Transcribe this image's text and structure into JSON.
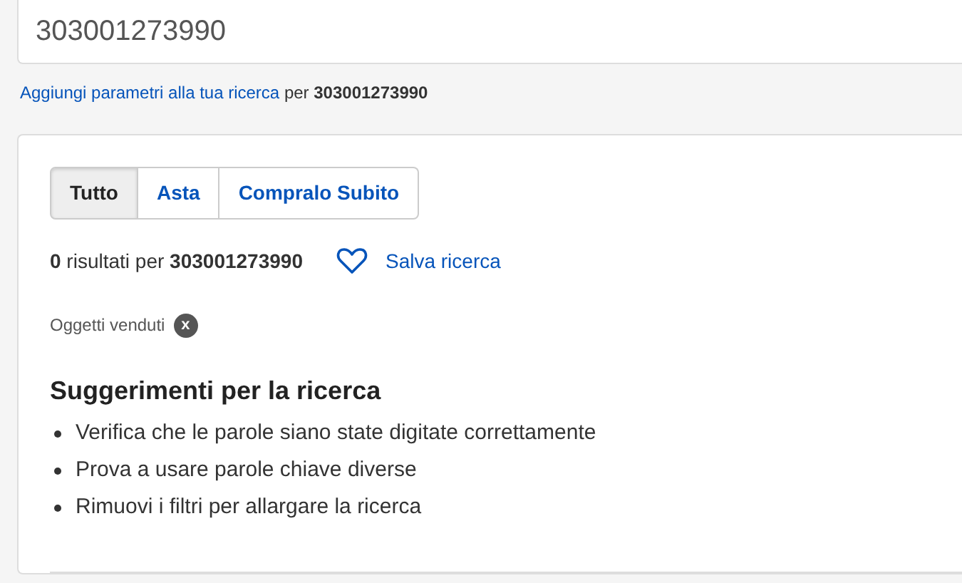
{
  "search": {
    "value": "303001273990"
  },
  "refine": {
    "link": "Aggiungi parametri alla tua ricerca",
    "rest": "per **303001273990**"
  },
  "tabs": [
    {
      "label": "Tutto",
      "selected": true
    },
    {
      "label": "Asta",
      "selected": false
    },
    {
      "label": "Compralo Subito",
      "selected": false
    }
  ],
  "results": {
    "count": "**0** risultati per **303001273990**",
    "save": "Salva ricerca"
  },
  "filters": [
    {
      "label": "Oggetti venduti",
      "remove": "x"
    }
  ],
  "suggestions": {
    "title": "Suggerimenti per la ricerca",
    "items": [
      "Verifica che le parole siano state digitate correttamente",
      "Prova a usare parole chiave diverse",
      "Rimuovi i filtri per allargare la ricerca"
    ]
  }
}
